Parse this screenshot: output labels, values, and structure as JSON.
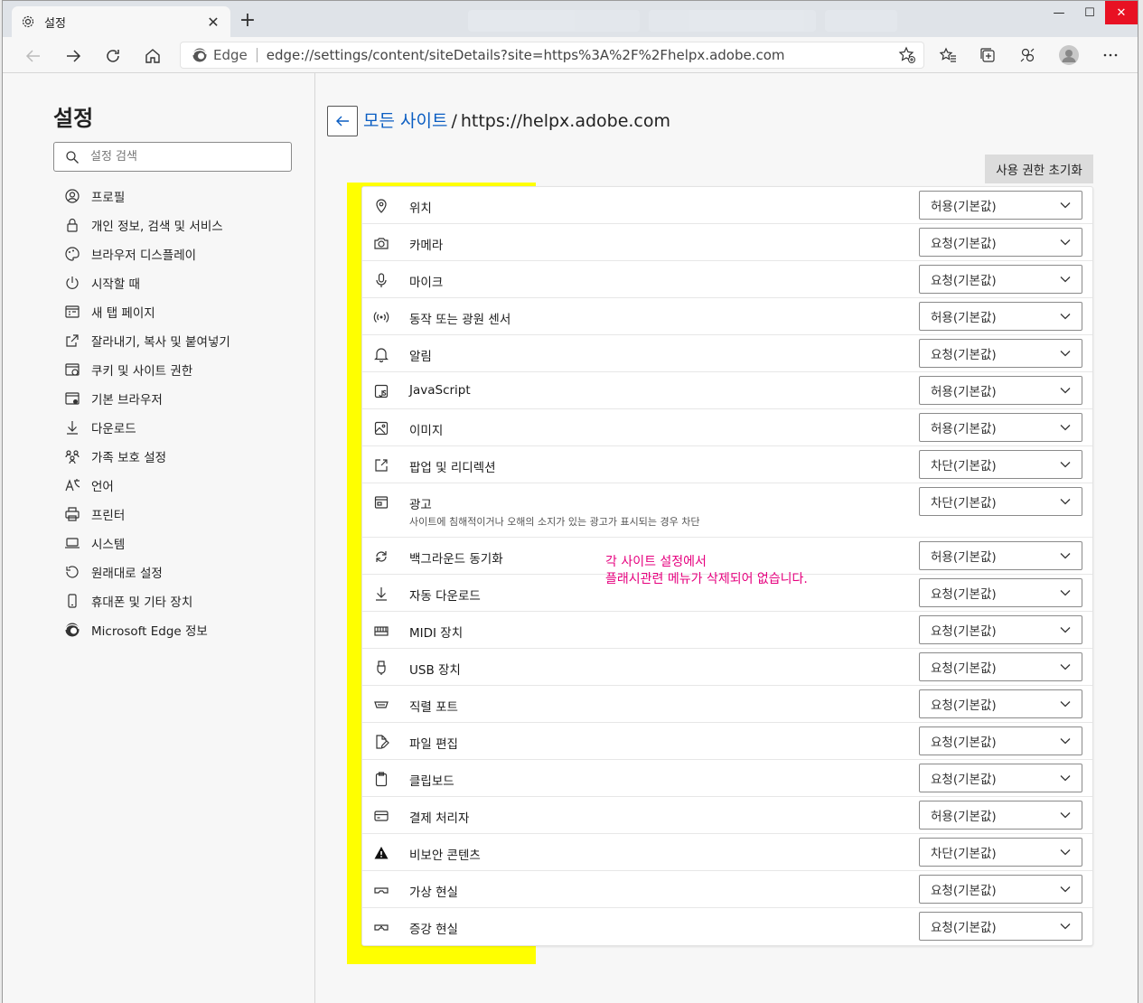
{
  "tab": {
    "title": "설정",
    "close": "✕",
    "new_tab": "+"
  },
  "window_controls": {
    "minimize": "—",
    "maximize": "☐",
    "close": "✕"
  },
  "address": {
    "browser_label": "Edge",
    "url": "edge://settings/content/siteDetails?site=https%3A%2F%2Fhelpx.adobe.com"
  },
  "sidebar": {
    "title": "설정",
    "search_placeholder": "설정 검색",
    "items": [
      {
        "label": "프로필",
        "icon": "profile-icon"
      },
      {
        "label": "개인 정보, 검색 및 서비스",
        "icon": "lock-icon"
      },
      {
        "label": "브라우저 디스플레이",
        "icon": "palette-icon"
      },
      {
        "label": "시작할 때",
        "icon": "power-icon"
      },
      {
        "label": "새 탭 페이지",
        "icon": "newtab-icon"
      },
      {
        "label": "잘라내기, 복사 및 붙여넣기",
        "icon": "share-icon"
      },
      {
        "label": "쿠키 및 사이트 권한",
        "icon": "cookie-icon"
      },
      {
        "label": "기본 브라우저",
        "icon": "browser-icon"
      },
      {
        "label": "다운로드",
        "icon": "download-icon"
      },
      {
        "label": "가족 보호 설정",
        "icon": "family-icon"
      },
      {
        "label": "언어",
        "icon": "language-icon"
      },
      {
        "label": "프린터",
        "icon": "printer-icon"
      },
      {
        "label": "시스템",
        "icon": "laptop-icon"
      },
      {
        "label": "원래대로 설정",
        "icon": "reset-icon"
      },
      {
        "label": "휴대폰 및 기타 장치",
        "icon": "phone-icon"
      },
      {
        "label": "Microsoft Edge 정보",
        "icon": "edge-icon"
      }
    ]
  },
  "main": {
    "breadcrumb_link": "모든 사이트",
    "breadcrumb_sep": "/",
    "site": "https://helpx.adobe.com",
    "reset_button": "사용 권한 초기화",
    "permissions": [
      {
        "label": "위치",
        "value": "허용(기본값)",
        "icon": "location-icon"
      },
      {
        "label": "카메라",
        "value": "요청(기본값)",
        "icon": "camera-icon"
      },
      {
        "label": "마이크",
        "value": "요청(기본값)",
        "icon": "microphone-icon"
      },
      {
        "label": "동작 또는 광원 센서",
        "value": "허용(기본값)",
        "icon": "sensor-icon"
      },
      {
        "label": "알림",
        "value": "요청(기본값)",
        "icon": "bell-icon"
      },
      {
        "label": "JavaScript",
        "value": "허용(기본값)",
        "icon": "javascript-icon"
      },
      {
        "label": "이미지",
        "value": "허용(기본값)",
        "icon": "image-icon"
      },
      {
        "label": "팝업 및 리디렉션",
        "value": "차단(기본값)",
        "icon": "popup-icon"
      },
      {
        "label": "광고",
        "value": "차단(기본값)",
        "icon": "ads-icon",
        "description": "사이트에 침해적이거나 오해의 소지가 있는 광고가 표시되는 경우 차단"
      },
      {
        "label": "백그라운드 동기화",
        "value": "허용(기본값)",
        "icon": "sync-icon"
      },
      {
        "label": "자동 다운로드",
        "value": "요청(기본값)",
        "icon": "download-icon"
      },
      {
        "label": "MIDI 장치",
        "value": "요청(기본값)",
        "icon": "midi-icon"
      },
      {
        "label": "USB 장치",
        "value": "요청(기본값)",
        "icon": "usb-icon"
      },
      {
        "label": "직렬 포트",
        "value": "요청(기본값)",
        "icon": "serial-port-icon"
      },
      {
        "label": "파일 편집",
        "value": "요청(기본값)",
        "icon": "file-edit-icon"
      },
      {
        "label": "클립보드",
        "value": "요청(기본값)",
        "icon": "clipboard-icon"
      },
      {
        "label": "결제 처리자",
        "value": "허용(기본값)",
        "icon": "card-icon"
      },
      {
        "label": "비보안 콘텐츠",
        "value": "차단(기본값)",
        "icon": "warning-icon"
      },
      {
        "label": "가상 현실",
        "value": "요청(기본값)",
        "icon": "vr-icon"
      },
      {
        "label": "증강 현실",
        "value": "요청(기본값)",
        "icon": "ar-icon"
      }
    ]
  },
  "annotation": {
    "line1": "각 사이트 설정에서",
    "line2": "플래시관련 메뉴가 삭제되어 없습니다."
  },
  "colors": {
    "highlight": "#ffff00",
    "annotation": "#e6007e",
    "link": "#0a5dc2"
  }
}
